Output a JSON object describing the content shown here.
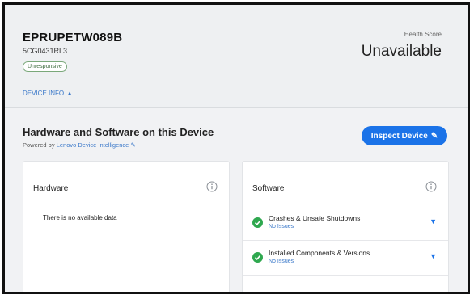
{
  "device": {
    "name": "EPRUPETW089B",
    "serial": "5CG0431RL3",
    "status": "Unresponsive",
    "info_toggle": "DEVICE INFO"
  },
  "health": {
    "label": "Health Score",
    "value": "Unavailable"
  },
  "section": {
    "title": "Hardware and Software on this Device",
    "powered_prefix": "Powered by",
    "powered_link": "Lenovo Device Intelligence",
    "inspect_button": "Inspect Device"
  },
  "hardware": {
    "title": "Hardware",
    "empty": "There is no available data"
  },
  "software": {
    "title": "Software",
    "items": [
      {
        "name": "Crashes & Unsafe Shutdowns",
        "status": "No Issues"
      },
      {
        "name": "Installed Components & Versions",
        "status": "No Issues"
      }
    ]
  },
  "colors": {
    "accent": "#1b73e8",
    "link": "#3a78c9",
    "success": "#2fa84f"
  }
}
